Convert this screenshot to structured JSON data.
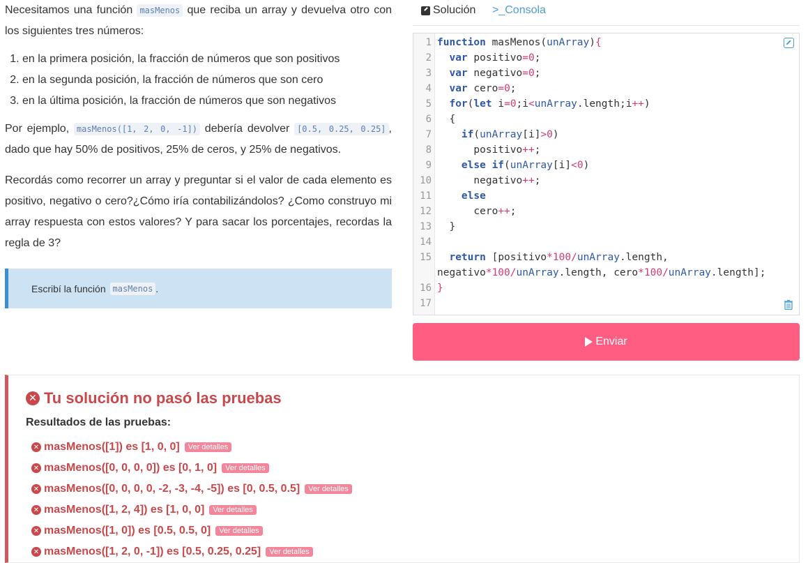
{
  "statement": {
    "intro_before": "Necesitamos una función",
    "intro_code": "masMenos",
    "intro_after": "que reciba un array y devuelva otro con los siguientes tres números:",
    "items": [
      "en la primera posición, la fracción de números que son positivos",
      "en la segunda posición, la fracción de números que son cero",
      "en la última posición, la fracción de números que son negativos"
    ],
    "example_before": "Por ejemplo,",
    "example_code": "masMenos([1, 2, 0, -1])",
    "example_middle": "debería devolver",
    "example_result": "[0.5, 0.25, 0.25]",
    "example_after": ", dado que hay 50% de positivos, 25% de ceros, y 25% de negativos.",
    "hint": "Recordás como recorrer un array y preguntar si el valor de cada elemento es positivo, negativo o cero?¿Cómo iría contabilizándolos? ¿Como construyo mi array respuesta con estos valores? Y para sacar los porcentajes, recordas la regla de 3?"
  },
  "task": {
    "text": "Escribí la función",
    "code": "masMenos",
    "period": "."
  },
  "tabs": {
    "solution": "Solución",
    "console": ">_Consola"
  },
  "editor": {
    "line_numbers": [
      "1",
      "2",
      "3",
      "4",
      "5",
      "6",
      "7",
      "8",
      "9",
      "10",
      "11",
      "12",
      "13",
      "14",
      "15",
      "",
      "16",
      "17"
    ]
  },
  "submit": {
    "label": "Enviar"
  },
  "results": {
    "title": "Tu solución no pasó las pruebas",
    "subtitle": "Resultados de las pruebas:",
    "detail_label": "Ver detalles",
    "tests": [
      "masMenos([1]) es [1, 0, 0]",
      "masMenos([0, 0, 0, 0]) es [0, 1, 0]",
      "masMenos([0, 0, 0, 0, -2, -3, -4, -5]) es [0, 0.5, 0.5]",
      "masMenos([1, 2, 4]) es [1, 0, 0]",
      "masMenos([1, 0]) es [0.5, 0.5, 0]",
      "masMenos([1, 2, 0, -1]) es [0.5, 0.25, 0.25]"
    ]
  }
}
